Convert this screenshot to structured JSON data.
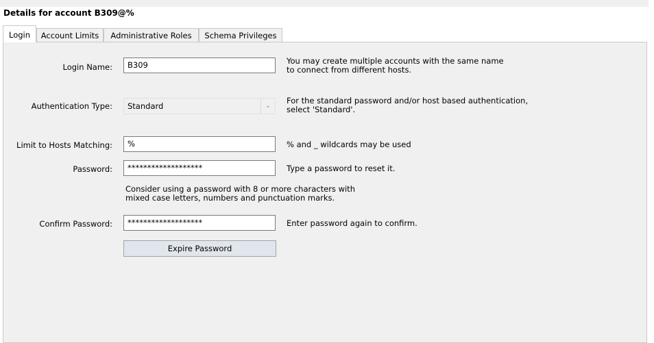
{
  "title": "Details for account B309@%",
  "tabs": [
    "Login",
    "Account Limits",
    "Administrative Roles",
    "Schema Privileges"
  ],
  "form": {
    "login_name": {
      "label": "Login Name:",
      "value": "B309",
      "help1": "You may create multiple accounts with the same name",
      "help2": "to connect from different hosts."
    },
    "auth_type": {
      "label": "Authentication Type:",
      "value": "Standard",
      "help1": "For the standard password and/or host based authentication,",
      "help2": "select 'Standard'."
    },
    "hosts": {
      "label": "Limit to Hosts Matching:",
      "value": "%",
      "help": "% and _ wildcards may be used"
    },
    "password": {
      "label": "Password:",
      "value": "*******************",
      "help": "Type a password to reset it.",
      "advice1": "Consider using a password with 8 or more characters with",
      "advice2": "mixed case letters, numbers and punctuation marks."
    },
    "confirm": {
      "label": "Confirm Password:",
      "value": "*******************",
      "help": "Enter password again to confirm."
    },
    "expire_button": "Expire Password"
  }
}
